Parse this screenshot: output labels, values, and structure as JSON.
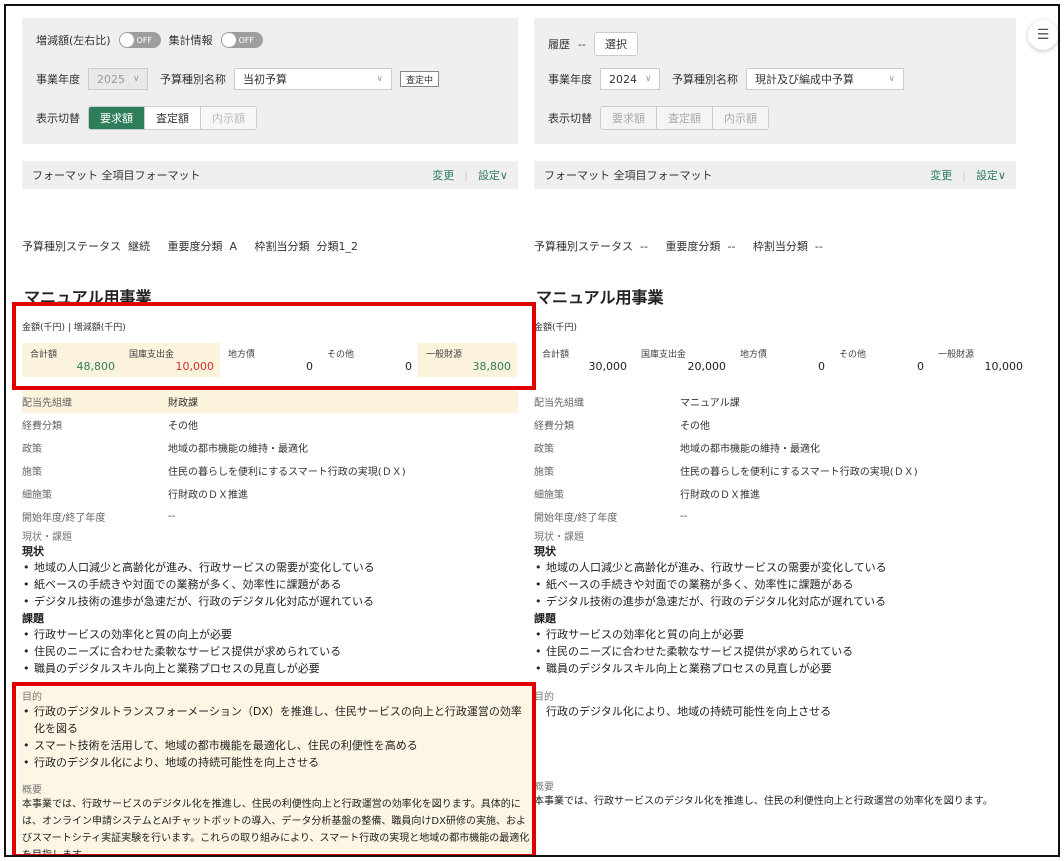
{
  "left": {
    "increase_label": "増減額(左右比)",
    "increase_toggle": "OFF",
    "summary_label": "集計情報",
    "summary_toggle": "OFF",
    "fiscal_year_label": "事業年度",
    "fiscal_year_value": "2025",
    "budget_type_label": "予算種別名称",
    "budget_type_value": "当初予算",
    "status_badge": "査定中",
    "display_label": "表示切替",
    "display_options": [
      "要求額",
      "査定額",
      "内示額"
    ],
    "display_selected": "要求額",
    "format_label": "フォーマット 全項目フォーマット",
    "format_change": "変更",
    "format_settings": "設定∨",
    "status_line": {
      "status_label": "予算種別ステータス",
      "status_value": "継続",
      "importance_label": "重要度分類",
      "importance_value": "A",
      "quota_label": "枠割当分類",
      "quota_value": "分類1_2"
    },
    "title": "マニュアル用事業",
    "money_header": "金額(千円) | 増減額(千円)",
    "money": [
      {
        "label": "合計額",
        "value": "48,800"
      },
      {
        "label": "国庫支出金",
        "value": "10,000"
      },
      {
        "label": "地方債",
        "value": "0"
      },
      {
        "label": "その他",
        "value": "0"
      },
      {
        "label": "一般財源",
        "value": "38,800"
      }
    ],
    "attrs": [
      {
        "k": "配当先組織",
        "v": "財政課"
      },
      {
        "k": "経費分類",
        "v": "その他"
      },
      {
        "k": "政策",
        "v": "地域の都市機能の維持・最適化"
      },
      {
        "k": "施策",
        "v": "住民の暮らしを便利にするスマート行政の実現(ＤＸ)"
      },
      {
        "k": "細施策",
        "v": "行財政のＤＸ推進"
      },
      {
        "k": "開始年度/終了年度",
        "v": "--"
      }
    ],
    "issue_label": "現状・課題",
    "current_head": "現状",
    "current_items": [
      "地域の人口減少と高齢化が進み、行政サービスの需要が変化している",
      "紙ベースの手続きや対面での業務が多く、効率性に課題がある",
      "デジタル技術の進歩が急速だが、行政のデジタル化対応が遅れている"
    ],
    "issue_head": "課題",
    "issue_items": [
      "行政サービスの効率化と質の向上が必要",
      "住民のニーズに合わせた柔軟なサービス提供が求められている",
      "職員のデジタルスキル向上と業務プロセスの見直しが必要"
    ],
    "purpose_label": "目的",
    "purpose_items": [
      "行政のデジタルトランスフォーメーション（DX）を推進し、住民サービスの向上と行政運営の効率化を図る",
      "スマート技術を活用して、地域の都市機能を最適化し、住民の利便性を高める",
      "行政のデジタル化により、地域の持続可能性を向上させる"
    ],
    "overview_label": "概要",
    "overview_text": "本事業では、行政サービスのデジタル化を推進し、住民の利便性向上と行政運営の効率化を図ります。具体的には、オンライン申請システムとAIチャットボットの導入、データ分析基盤の整備、職員向けDX研修の実施、およびスマートシティ実証実験を行います。これらの取り組みにより、スマート行政の実現と地域の都市機能の最適化を目指します。"
  },
  "right": {
    "history_label": "履歴",
    "history_value": "--",
    "select_button": "選択",
    "fiscal_year_label": "事業年度",
    "fiscal_year_value": "2024",
    "budget_type_label": "予算種別名称",
    "budget_type_value": "現計及び編成中予算",
    "display_label": "表示切替",
    "display_options": [
      "要求額",
      "査定額",
      "内示額"
    ],
    "format_label": "フォーマット 全項目フォーマット",
    "format_change": "変更",
    "format_settings": "設定∨",
    "status_line": {
      "status_label": "予算種別ステータス",
      "status_value": "--",
      "importance_label": "重要度分類",
      "importance_value": "--",
      "quota_label": "枠割当分類",
      "quota_value": "--"
    },
    "title": "マニュアル用事業",
    "money_header": "金額(千円)",
    "money": [
      {
        "label": "合計額",
        "value": "30,000"
      },
      {
        "label": "国庫支出金",
        "value": "20,000"
      },
      {
        "label": "地方債",
        "value": "0"
      },
      {
        "label": "その他",
        "value": "0"
      },
      {
        "label": "一般財源",
        "value": "10,000"
      }
    ],
    "attrs": [
      {
        "k": "配当先組織",
        "v": "マニュアル課"
      },
      {
        "k": "経費分類",
        "v": "その他"
      },
      {
        "k": "政策",
        "v": "地域の都市機能の維持・最適化"
      },
      {
        "k": "施策",
        "v": "住民の暮らしを便利にするスマート行政の実現(ＤＸ)"
      },
      {
        "k": "細施策",
        "v": "行財政のＤＸ推進"
      },
      {
        "k": "開始年度/終了年度",
        "v": "--"
      }
    ],
    "issue_label": "現状・課題",
    "current_head": "現状",
    "current_items": [
      "地域の人口減少と高齢化が進み、行政サービスの需要が変化している",
      "紙ベースの手続きや対面での業務が多く、効率性に課題がある",
      "デジタル技術の進歩が急速だが、行政のデジタル化対応が遅れている"
    ],
    "issue_head": "課題",
    "issue_items": [
      "行政サービスの効率化と質の向上が必要",
      "住民のニーズに合わせた柔軟なサービス提供が求められている",
      "職員のデジタルスキル向上と業務プロセスの見直しが必要"
    ],
    "purpose_label": "目的",
    "purpose_text": "行政のデジタル化により、地域の持続可能性を向上させる",
    "overview_label": "概要",
    "overview_text": "本事業では、行政サービスのデジタル化を推進し、住民の利便性向上と行政運営の効率化を図ります。"
  },
  "colors": {
    "accent_green": "#2e7d5b",
    "highlight_box": "#e00000",
    "highlight_bg": "#fcf3dd"
  }
}
